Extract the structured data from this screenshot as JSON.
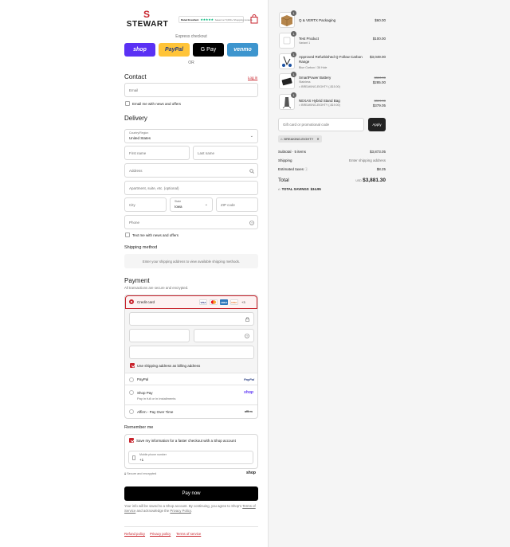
{
  "header": {
    "brand_initial": "S",
    "brand_name": "STEWART",
    "rating_label": "Rated Excellent",
    "rating_stars": "★★★★★",
    "rating_note": "based on 5,000+ Shopping reviews"
  },
  "express": {
    "title": "Express checkout",
    "shop_label": "shop",
    "paypal_label": "PayPal",
    "gpay_label": "G Pay",
    "venmo_label": "venmo",
    "or_label": "OR"
  },
  "contact": {
    "title": "Contact",
    "login_label": "Log in",
    "email_placeholder": "Email",
    "newsletter_label": "Email me with news and offers"
  },
  "delivery": {
    "title": "Delivery",
    "country_label": "Country/Region",
    "country_value": "United States",
    "first_name_placeholder": "First name",
    "last_name_placeholder": "Last name",
    "address_placeholder": "Address",
    "apartment_placeholder": "Apartment, suite, etc. (optional)",
    "city_placeholder": "City",
    "state_label": "State",
    "state_value": "Iowa",
    "zip_placeholder": "ZIP code",
    "phone_placeholder": "Phone",
    "text_label": "Text me with news and offers"
  },
  "shipping": {
    "title": "Shipping method",
    "message": "Enter your shipping address to view available shipping methods."
  },
  "payment": {
    "title": "Payment",
    "subtitle": "All transactions are secure and encrypted.",
    "credit_card_label": "Credit card",
    "card_more": "+3",
    "billing_label": "Use shipping address as billing address",
    "paypal_label": "PayPal",
    "paypal_logo": "PayPal",
    "shoppay_label": "Shop Pay",
    "shoppay_sub": "Pay in full or in installments",
    "shoppay_logo": "shop",
    "affirm_label": "Affirm - Pay Over Time",
    "affirm_logo": "affirm"
  },
  "remember": {
    "title": "Remember me",
    "save_label": "Save my information for a faster checkout with a Shop account",
    "mobile_label": "Mobile phone number",
    "mobile_value": "+1",
    "secure_label": "Secure and encrypted",
    "shop_logo": "shop"
  },
  "paynow": {
    "label": "Pay now",
    "disclaimer_1": "Your info will be saved to a Shop account. By continuing, you agree to Shop's",
    "terms_link": "Terms of Service",
    "disclaimer_2": "and acknowledge the",
    "privacy_link": "Privacy Policy",
    "period": "."
  },
  "footer": {
    "refund": "Refund policy",
    "privacy": "Privacy policy",
    "terms": "Terms of service"
  },
  "cart": {
    "items": [
      {
        "qty": "1",
        "name": "Q & VERTX Packaging",
        "price": "$60.00"
      },
      {
        "qty": "1",
        "name": "Test Product",
        "variant": "Variant 1",
        "price": "$100.00"
      },
      {
        "qty": "1",
        "name": "Approved Refurbished Q Follow Carbon Range",
        "variant": "Blue Carbon / 36 Hole",
        "price": "$3,049.00"
      },
      {
        "qty": "1",
        "name": "SmartPower Battery",
        "variant": "Stainless",
        "discount": "BREAKING-EIGHTY (-$15.00)",
        "old_price": "$300.00",
        "price": "$285.00"
      },
      {
        "qty": "1",
        "name": "NEXAS Hybrid Stand Bag",
        "variant": "",
        "discount": "BREAKING-EIGHTY (-$19.00)",
        "old_price": "$399.00",
        "price": "$379.05"
      }
    ],
    "gift_placeholder": "Gift card or promotional code",
    "apply_label": "Apply",
    "applied_code": "BREAKING-EIGHTY",
    "subtotal_label": "Subtotal · 5 items",
    "subtotal_value": "$3,873.05",
    "shipping_label": "Shipping",
    "shipping_value": "Enter shipping address",
    "taxes_label": "Estimated taxes",
    "taxes_value": "$8.25",
    "total_label": "Total",
    "currency": "USD",
    "total_value": "$3,881.30",
    "savings_label": "TOTAL SAVINGS",
    "savings_value": "$34.95"
  },
  "colors": {
    "accent": "#c8232c",
    "shop": "#5a31f4",
    "paypal": "#ffc439",
    "venmo": "#3d95ce"
  }
}
